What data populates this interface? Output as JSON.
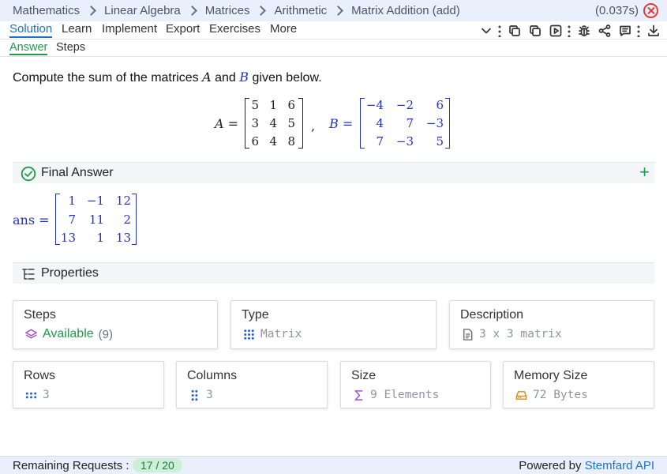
{
  "breadcrumb": [
    "Mathematics",
    "Linear Algebra",
    "Matrices",
    "Arithmetic",
    "Matrix Addition (add)"
  ],
  "timing": "(0.037s)",
  "tabs": [
    "Solution",
    "Learn",
    "Implement",
    "Export",
    "Exercises",
    "More"
  ],
  "subtabs": [
    "Answer",
    "Steps"
  ],
  "problem": {
    "prefix": "Compute the sum of the matrices",
    "var_a": "A",
    "and": "and",
    "var_b": "B",
    "suffix": "given below."
  },
  "matrix_a": {
    "label": "A =",
    "rows": [
      [
        "5",
        "1",
        "6"
      ],
      [
        "3",
        "4",
        "5"
      ],
      [
        "6",
        "4",
        "8"
      ]
    ]
  },
  "separator": ",",
  "matrix_b": {
    "label": "B =",
    "rows": [
      [
        "−4",
        "−2",
        "6"
      ],
      [
        "4",
        "7",
        "−3"
      ],
      [
        "7",
        "−3",
        "5"
      ]
    ]
  },
  "final_answer": {
    "title": "Final Answer",
    "label": "ans =",
    "rows": [
      [
        "1",
        "−1",
        "12"
      ],
      [
        "7",
        "11",
        "2"
      ],
      [
        "13",
        "1",
        "13"
      ]
    ]
  },
  "properties": {
    "title": "Properties",
    "steps": {
      "title": "Steps",
      "value": "Available",
      "count": "(9)"
    },
    "type": {
      "title": "Type",
      "value": "Matrix"
    },
    "description": {
      "title": "Description",
      "value": "3 x 3 matrix"
    },
    "rows": {
      "title": "Rows",
      "value": "3"
    },
    "columns": {
      "title": "Columns",
      "value": "3"
    },
    "size": {
      "title": "Size",
      "value": "9 Elements"
    },
    "memory": {
      "title": "Memory Size",
      "value": "72 Bytes"
    }
  },
  "footer": {
    "remaining_label": "Remaining Requests :",
    "remaining_value": "17 / 20",
    "powered_prefix": "Powered by",
    "powered_link": "Stemfard API"
  },
  "colors": {
    "accent_blue": "#1a73c8",
    "accent_green": "#1f9a4b",
    "matrix_blue": "#2330c8",
    "close_red": "#e23a3a"
  }
}
